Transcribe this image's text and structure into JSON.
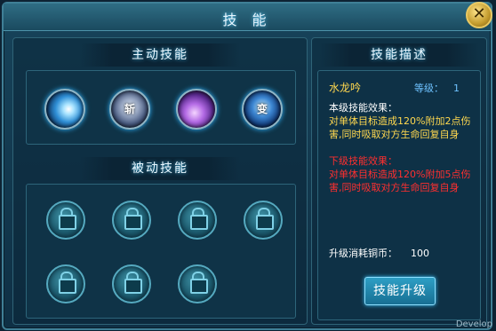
{
  "window": {
    "title": "技 能",
    "close_icon": "close-icon"
  },
  "active_section": {
    "header": "主动技能",
    "skills": [
      {
        "icon": "water-orb-skill-icon",
        "glyph": ""
      },
      {
        "icon": "silver-skill-icon",
        "glyph": "斩"
      },
      {
        "icon": "purple-flower-skill-icon",
        "glyph": ""
      },
      {
        "icon": "blue-skill-icon",
        "glyph": "变"
      }
    ]
  },
  "passive_section": {
    "header": "被动技能",
    "slots": [
      {
        "state": "locked"
      },
      {
        "state": "locked"
      },
      {
        "state": "locked"
      },
      {
        "state": "locked"
      },
      {
        "state": "locked"
      },
      {
        "state": "locked"
      },
      {
        "state": "locked"
      }
    ]
  },
  "description": {
    "header": "技能描述",
    "skill_name": "水龙吟",
    "level_label": "等级：",
    "level_value": "1",
    "current_title": "本级技能效果：",
    "current_text": "对单体目标造成120%附加2点伤害,同时吸取对方生命回复自身",
    "next_title": "下级技能效果：",
    "next_text": "对单体目标造成120%附加5点伤害,同时吸取对方生命回复自身",
    "cost_label": "升级消耗铜币：",
    "cost_value": "100",
    "upgrade_button": "技能升级"
  },
  "watermark": "Develop",
  "colors": {
    "panel": "#17435a",
    "gold_text": "#ffd84f",
    "red_text": "#ff2f2f",
    "blue_text": "#6ec2ff"
  }
}
